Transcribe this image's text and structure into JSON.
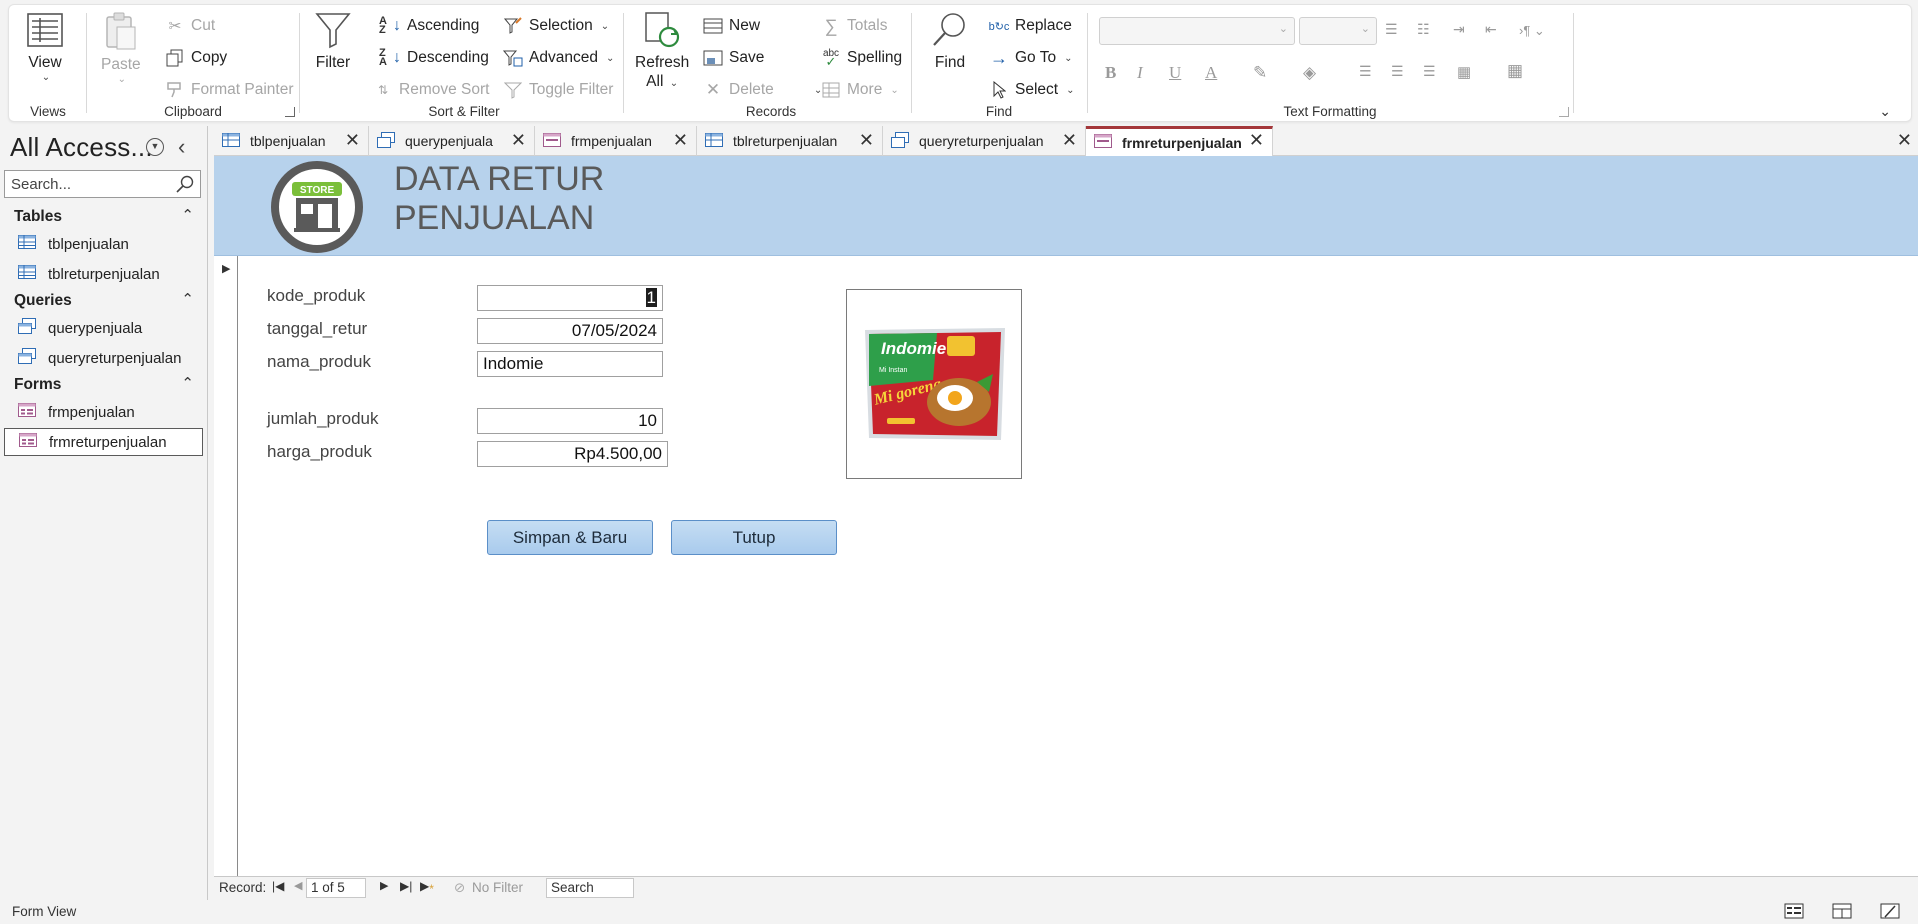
{
  "ribbon": {
    "views": {
      "view_label": "View",
      "group_label": "Views"
    },
    "clipboard": {
      "paste": "Paste",
      "cut": "Cut",
      "copy": "Copy",
      "format_painter": "Format Painter",
      "group_label": "Clipboard"
    },
    "sort_filter": {
      "filter": "Filter",
      "ascending": "Ascending",
      "descending": "Descending",
      "remove_sort": "Remove Sort",
      "selection": "Selection",
      "advanced": "Advanced",
      "toggle_filter": "Toggle Filter",
      "group_label": "Sort & Filter"
    },
    "records": {
      "refresh_line1": "Refresh",
      "refresh_line2": "All",
      "new": "New",
      "save": "Save",
      "delete": "Delete",
      "totals": "Totals",
      "spelling": "Spelling",
      "more": "More",
      "group_label": "Records"
    },
    "find": {
      "find": "Find",
      "replace": "Replace",
      "goto": "Go To",
      "select": "Select",
      "group_label": "Find"
    },
    "text_formatting": {
      "group_label": "Text Formatting",
      "bold": "B",
      "italic": "I",
      "underline": "U",
      "font_color": "A"
    }
  },
  "nav": {
    "title": "All Access...",
    "search_placeholder": "Search...",
    "sections": [
      {
        "label": "Tables",
        "items": [
          "tblpenjualan",
          "tblreturpenjualan"
        ]
      },
      {
        "label": "Queries",
        "items": [
          "querypenjuala",
          "queryreturpenjualan"
        ]
      },
      {
        "label": "Forms",
        "items": [
          "frmpenjualan",
          "frmreturpenjualan"
        ]
      }
    ],
    "selected_item": "frmreturpenjualan"
  },
  "tabs": [
    {
      "label": "tblpenjualan",
      "type": "table"
    },
    {
      "label": "querypenjuala",
      "type": "query"
    },
    {
      "label": "frmpenjualan",
      "type": "form"
    },
    {
      "label": "tblreturpenjualan",
      "type": "table"
    },
    {
      "label": "queryreturpenjualan",
      "type": "query"
    },
    {
      "label": "frmreturpenjualan",
      "type": "form",
      "active": true
    }
  ],
  "form": {
    "title": "DATA RETUR\nPENJUALAN",
    "logo_text": "STORE",
    "fields": {
      "kode_produk": {
        "label": "kode_produk",
        "value": "1"
      },
      "tanggal_retur": {
        "label": "tanggal_retur",
        "value": "07/05/2024"
      },
      "nama_produk": {
        "label": "nama_produk",
        "value": "Indomie"
      },
      "jumlah_produk": {
        "label": "jumlah_produk",
        "value": "10"
      },
      "harga_produk": {
        "label": "harga_produk",
        "value": "Rp4.500,00"
      }
    },
    "product_image": {
      "brand": "Indomie",
      "flavor": "Mi goreng",
      "subtitle": "Mi Instan"
    },
    "buttons": {
      "save_new": "Simpan & Baru",
      "close": "Tutup"
    }
  },
  "record_nav": {
    "record_label": "Record:",
    "position": "1 of 5",
    "filter_status": "No Filter",
    "search": "Search"
  },
  "status": {
    "view_name": "Form View"
  },
  "colors": {
    "header_bg": "#b7d2ec",
    "button_bg": "#b3d2f0",
    "active_tab_accent": "#a4373a"
  }
}
